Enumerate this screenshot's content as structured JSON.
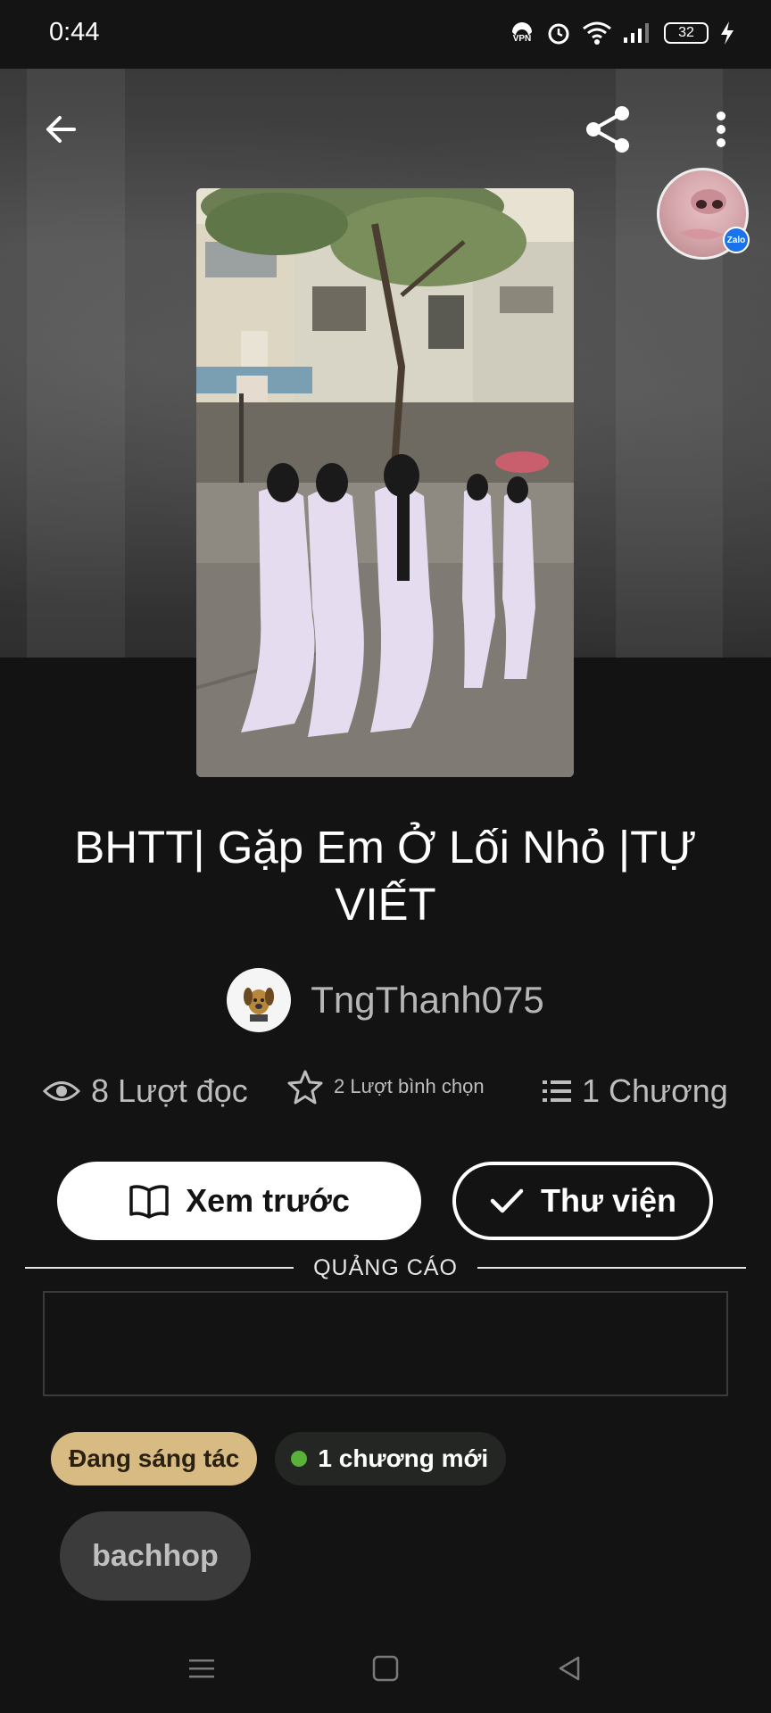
{
  "status_bar": {
    "time": "0:44",
    "vpn_label": "VPN",
    "battery": "32"
  },
  "top_bar": {
    "back_icon": "arrow-left-icon",
    "share_icon": "share-icon",
    "more_icon": "more-vertical-icon"
  },
  "floating_bubble": {
    "badge": "Zalo"
  },
  "story": {
    "title": "BHTT| Gặp Em Ở Lối Nhỏ |TỰ VIẾT",
    "author": "TngThanh075",
    "stats": {
      "reads": "8 Lượt đọc",
      "votes": "2 Lượt bình chọn",
      "chapters": "1 Chương"
    }
  },
  "actions": {
    "preview_label": "Xem trước",
    "library_label": "Thư viện"
  },
  "ad": {
    "label": "QUẢNG CÁO"
  },
  "tags": {
    "status": "Đang sáng tác",
    "new_chapters": "1 chương mới",
    "chips": [
      "bachhop"
    ]
  },
  "colors": {
    "background": "#131313",
    "status_tag": "#d8bb82",
    "new_dot": "#5ab13a"
  }
}
